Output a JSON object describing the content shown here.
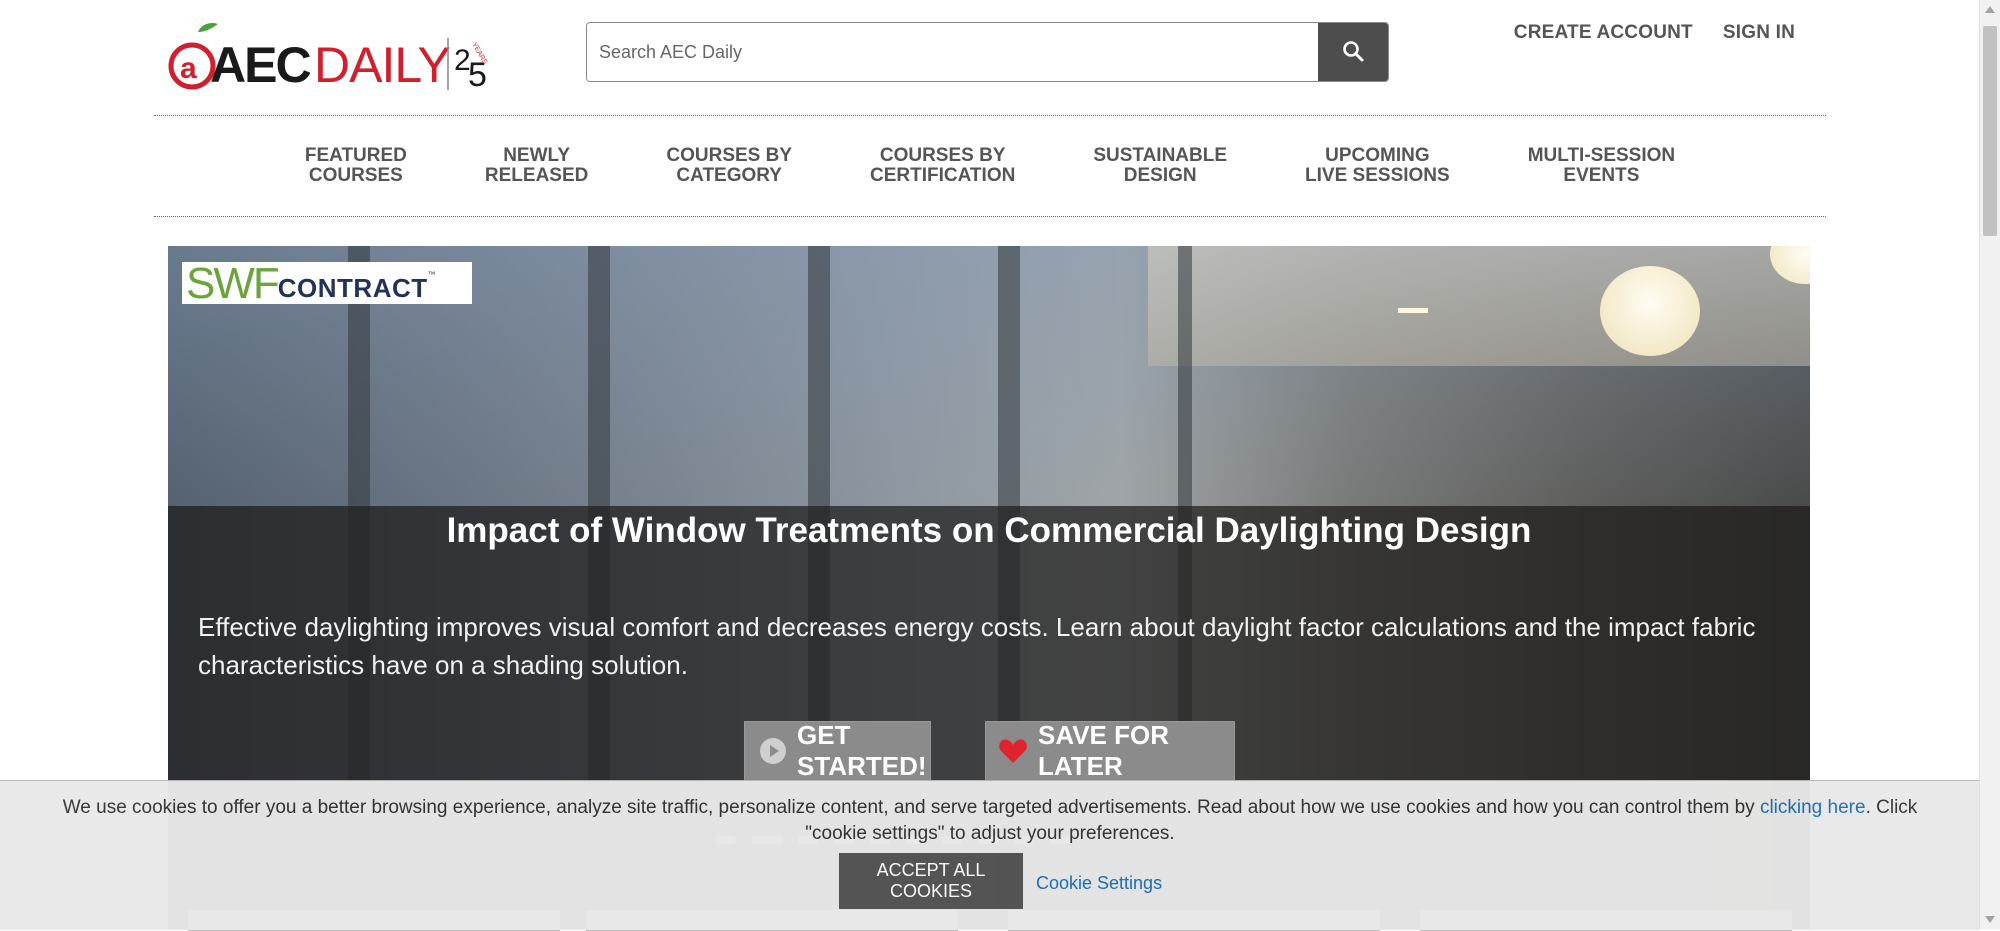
{
  "header": {
    "logo_text": "@AECDAILY",
    "logo_years_number": "25",
    "logo_years_label": "YEARS",
    "search_placeholder": "Search AEC Daily",
    "create_account": "CREATE ACCOUNT",
    "sign_in": "SIGN IN",
    "icons": {
      "search": "search-icon"
    }
  },
  "nav": {
    "items": [
      {
        "line1": "FEATURED",
        "line2": "COURSES"
      },
      {
        "line1": "NEWLY",
        "line2": "RELEASED"
      },
      {
        "line1": "COURSES BY",
        "line2": "CATEGORY"
      },
      {
        "line1": "COURSES BY",
        "line2": "CERTIFICATION"
      },
      {
        "line1": "SUSTAINABLE",
        "line2": "DESIGN"
      },
      {
        "line1": "UPCOMING",
        "line2": "LIVE SESSIONS"
      },
      {
        "line1": "MULTI-SESSION",
        "line2": "EVENTS"
      }
    ]
  },
  "hero": {
    "brand_swf": "SWF",
    "brand_contract": "CONTRACT",
    "brand_tm": "™",
    "title": "Impact of Window Treatments on Commercial Daylighting Design",
    "description": "Effective daylighting improves visual comfort and decreases energy costs. Learn about daylight factor calculations and the impact fabric characteristics have on a shading solution.",
    "get_started": "GET STARTED!",
    "save_for_later": "SAVE FOR LATER",
    "icons": {
      "play": "play-circle-icon",
      "heart": "heart-icon"
    }
  },
  "cookie": {
    "icon_glyph": "",
    "text_before": "We use cookies to offer you a better browsing experience, analyze site traffic, personalize content, and serve targeted advertisements. Read about how we use cookies and how you can control them by ",
    "link_text": "clicking here",
    "text_after": ". Click \"cookie settings\" to adjust your preferences.",
    "accept": "ACCEPT ALL COOKIES",
    "settings": "Cookie Settings"
  },
  "colors": {
    "nav_text": "#555555",
    "search_button": "#4d4d4d",
    "logo_red": "#d0202e",
    "logo_green": "#4aa23a",
    "hero_button": "#8b8b8b",
    "heart": "#e0242f",
    "link_blue": "#1d6fb5",
    "accept_button": "#555555"
  }
}
